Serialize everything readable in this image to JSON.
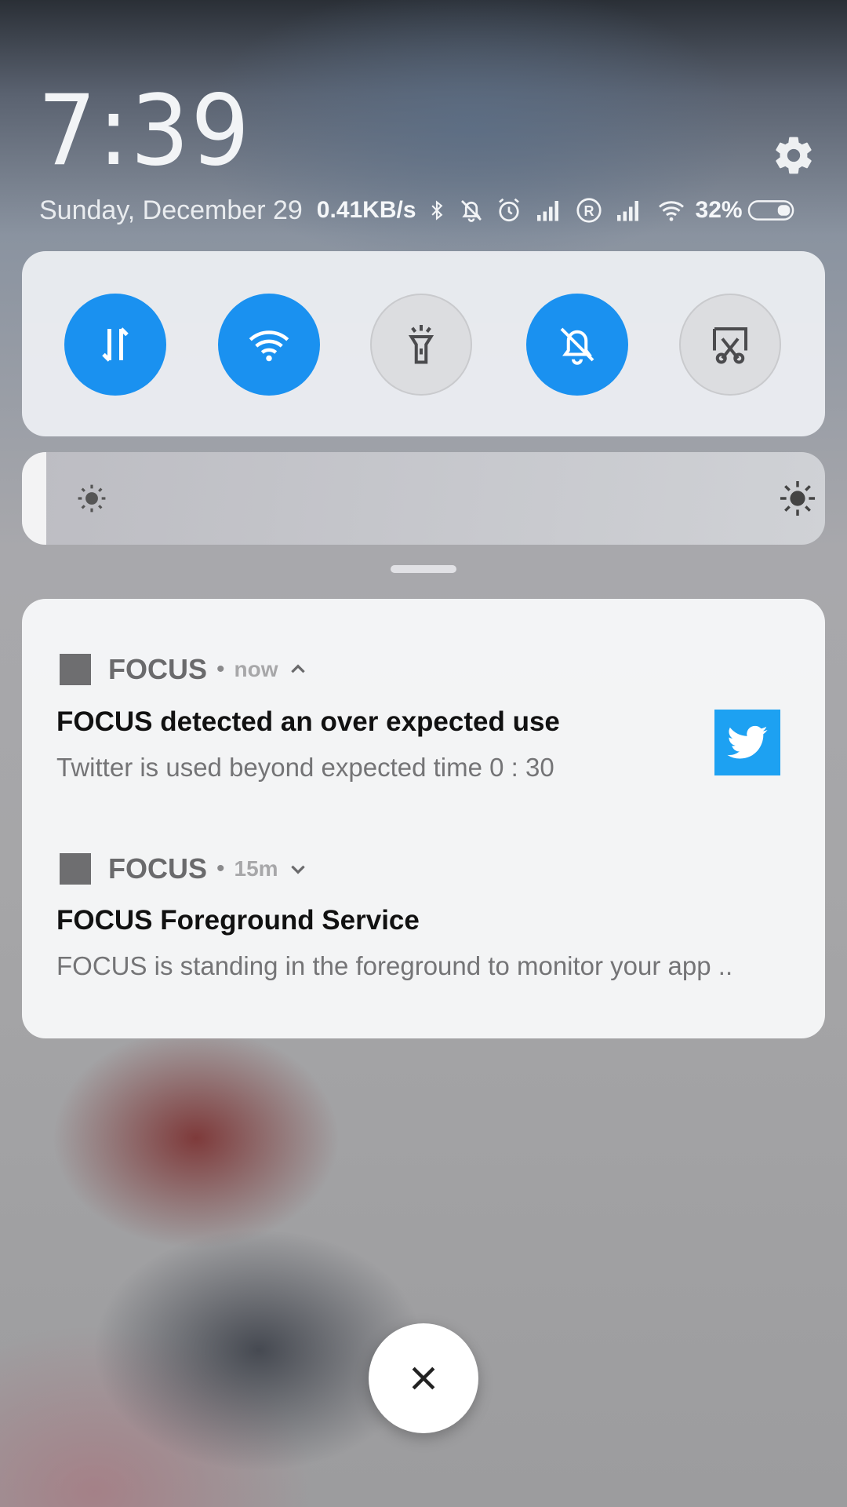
{
  "status": {
    "clock": "7:39",
    "date": "Sunday, December 29",
    "network_speed": "0.41KB/s",
    "battery_percent": "32%",
    "battery_level": 0.32,
    "icons": [
      "bluetooth-icon",
      "silent-icon",
      "alarm-icon",
      "signal-icon",
      "roaming-icon",
      "signal-icon",
      "wifi-icon",
      "battery-icon"
    ]
  },
  "quick_settings": {
    "toggles": [
      {
        "name": "mobile-data",
        "icon": "data-transfer-icon",
        "state": "on"
      },
      {
        "name": "wifi",
        "icon": "wifi-icon",
        "state": "on"
      },
      {
        "name": "flashlight",
        "icon": "flashlight-icon",
        "state": "off"
      },
      {
        "name": "silent",
        "icon": "bell-off-icon",
        "state": "on"
      },
      {
        "name": "screenshot",
        "icon": "screenshot-scissors-icon",
        "state": "off"
      }
    ],
    "brightness_level": 0.03
  },
  "notifications": [
    {
      "app": "FOCUS",
      "time": "now",
      "expanded": true,
      "title": "FOCUS detected an over expected use",
      "body": "Twitter is used beyond expected time 0 : 30",
      "thumbnail": "twitter-bird-icon"
    },
    {
      "app": "FOCUS",
      "time": "15m",
      "expanded": false,
      "title": "FOCUS Foreground Service",
      "body": "FOCUS is standing in the foreground to monitor your app .."
    }
  ],
  "colors": {
    "accent": "#1a91f0",
    "twitter": "#1da1f2"
  }
}
